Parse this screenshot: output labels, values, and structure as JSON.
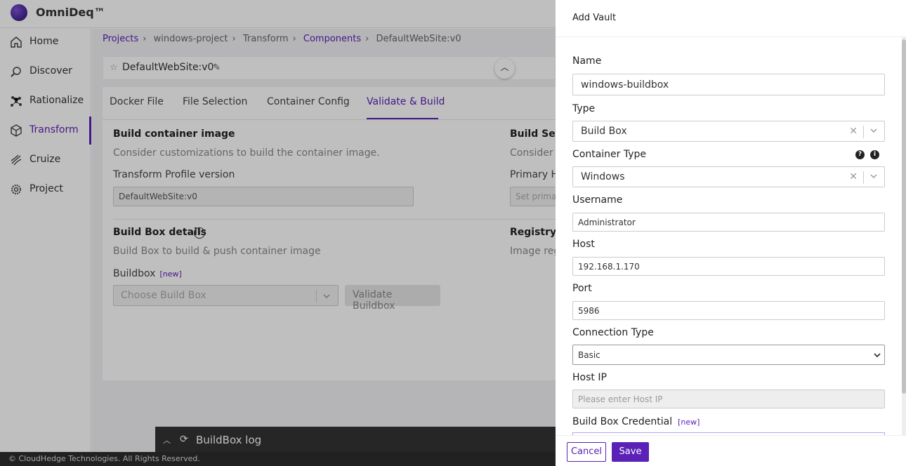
{
  "app": {
    "brand": "OmniDeq™"
  },
  "sidebar": {
    "items": [
      {
        "label": "Home",
        "icon": "home-icon"
      },
      {
        "label": "Discover",
        "icon": "discover-icon"
      },
      {
        "label": "Rationalize",
        "icon": "rationalize-icon"
      },
      {
        "label": "Transform",
        "icon": "cube-icon"
      },
      {
        "label": "Cruize",
        "icon": "cruize-icon"
      },
      {
        "label": "Project",
        "icon": "gear-icon"
      }
    ],
    "active": "Transform"
  },
  "breadcrumb": [
    "Projects",
    "windows-project",
    "Transform",
    "Components",
    "DefaultWebSite:v0"
  ],
  "title": "DefaultWebSite:v0",
  "tabs": [
    "Docker File",
    "File Selection",
    "Container Config",
    "Validate & Build"
  ],
  "active_tab": "Validate & Build",
  "build": {
    "heading": "Build container image",
    "sub": "Consider customizations to build the container image.",
    "profile_label": "Transform Profile version",
    "profile_value": "DefaultWebSite:v0",
    "settings_heading": "Build Setti",
    "settings_sub": "Consider c",
    "primary_label": "Primary Ho",
    "primary_placeholder": "Set prima"
  },
  "buildbox": {
    "heading": "Build Box details",
    "sub": "Build Box to build & push container image",
    "label": "Buildbox",
    "new": "[new]",
    "placeholder": "Choose Build Box",
    "validate": "Validate Buildbox",
    "registry_heading": "Registry c",
    "registry_sub": "Image reg"
  },
  "log": {
    "label": "BuildBox log"
  },
  "footer": "© CloudHedge Technologies. All Rights Reserved.",
  "drawer": {
    "title": "Add Vault",
    "name_label": "Name",
    "name_value": "windows-buildbox",
    "type_label": "Type",
    "type_value": "Build Box",
    "ctype_label": "Container Type",
    "ctype_value": "Windows",
    "user_label": "Username",
    "user_value": "Administrator",
    "host_label": "Host",
    "host_value": "192.168.1.170",
    "port_label": "Port",
    "port_value": "5986",
    "conn_label": "Connection Type",
    "conn_value": "Basic",
    "hostip_label": "Host IP",
    "hostip_placeholder": "Please enter Host IP",
    "cred_label": "Build Box Credential",
    "cred_new": "[new]",
    "cancel": "Cancel",
    "save": "Save"
  }
}
